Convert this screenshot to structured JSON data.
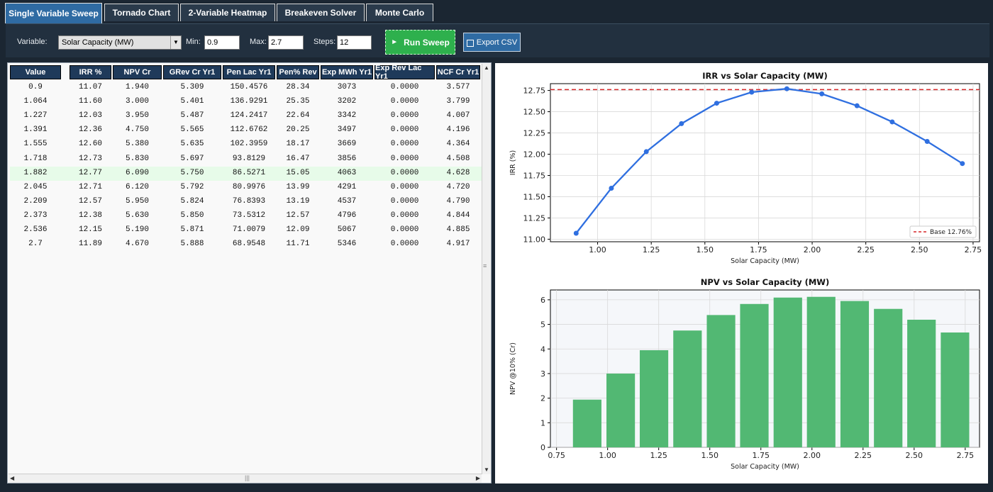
{
  "tabs": [
    {
      "label": "Single Variable Sweep",
      "active": true
    },
    {
      "label": "Tornado Chart",
      "active": false
    },
    {
      "label": "2-Variable Heatmap",
      "active": false
    },
    {
      "label": "Breakeven Solver",
      "active": false
    },
    {
      "label": "Monte Carlo",
      "active": false
    }
  ],
  "toolbar": {
    "variable_label": "Variable:",
    "variable_value": "Solar Capacity (MW)",
    "min_label": "Min:",
    "min_value": "0.9",
    "max_label": "Max:",
    "max_value": "2.7",
    "steps_label": "Steps:",
    "steps_value": "12",
    "run_label": "Run Sweep",
    "export_label": "Export CSV"
  },
  "table": {
    "columns": [
      "Value",
      "IRR %",
      "NPV Cr",
      "GRev Cr Yr1",
      "Pen Lac Yr1",
      "Pen% Rev",
      "Exp MWh Yr1",
      "Exp Rev Lac Yr1",
      "NCF Cr Yr1"
    ],
    "rows": [
      [
        "0.9",
        "11.07",
        "1.940",
        "5.309",
        "150.4576",
        "28.34",
        "3073",
        "0.0000",
        "3.577"
      ],
      [
        "1.064",
        "11.60",
        "3.000",
        "5.401",
        "136.9291",
        "25.35",
        "3202",
        "0.0000",
        "3.799"
      ],
      [
        "1.227",
        "12.03",
        "3.950",
        "5.487",
        "124.2417",
        "22.64",
        "3342",
        "0.0000",
        "4.007"
      ],
      [
        "1.391",
        "12.36",
        "4.750",
        "5.565",
        "112.6762",
        "20.25",
        "3497",
        "0.0000",
        "4.196"
      ],
      [
        "1.555",
        "12.60",
        "5.380",
        "5.635",
        "102.3959",
        "18.17",
        "3669",
        "0.0000",
        "4.364"
      ],
      [
        "1.718",
        "12.73",
        "5.830",
        "5.697",
        "93.8129",
        "16.47",
        "3856",
        "0.0000",
        "4.508"
      ],
      [
        "1.882",
        "12.77",
        "6.090",
        "5.750",
        "86.5271",
        "15.05",
        "4063",
        "0.0000",
        "4.628"
      ],
      [
        "2.045",
        "12.71",
        "6.120",
        "5.792",
        "80.9976",
        "13.99",
        "4291",
        "0.0000",
        "4.720"
      ],
      [
        "2.209",
        "12.57",
        "5.950",
        "5.824",
        "76.8393",
        "13.19",
        "4537",
        "0.0000",
        "4.790"
      ],
      [
        "2.373",
        "12.38",
        "5.630",
        "5.850",
        "73.5312",
        "12.57",
        "4796",
        "0.0000",
        "4.844"
      ],
      [
        "2.536",
        "12.15",
        "5.190",
        "5.871",
        "71.0079",
        "12.09",
        "5067",
        "0.0000",
        "4.885"
      ],
      [
        "2.7",
        "11.89",
        "4.670",
        "5.888",
        "68.9548",
        "11.71",
        "5346",
        "0.0000",
        "4.917"
      ]
    ],
    "highlight_row": 6
  },
  "chart_data": [
    {
      "type": "line",
      "title": "IRR vs Solar Capacity (MW)",
      "xlabel": "Solar Capacity (MW)",
      "ylabel": "IRR (%)",
      "x": [
        0.9,
        1.064,
        1.227,
        1.391,
        1.555,
        1.718,
        1.882,
        2.045,
        2.209,
        2.373,
        2.536,
        2.7
      ],
      "y": [
        11.07,
        11.6,
        12.03,
        12.36,
        12.6,
        12.73,
        12.77,
        12.71,
        12.57,
        12.38,
        12.15,
        11.89
      ],
      "xlim": [
        0.78,
        2.78
      ],
      "ylim": [
        10.97,
        12.83
      ],
      "xticks": [
        "1.00",
        "1.25",
        "1.50",
        "1.75",
        "2.00",
        "2.25",
        "2.50",
        "2.75"
      ],
      "yticks": [
        "11.00",
        "11.25",
        "11.50",
        "11.75",
        "12.00",
        "12.25",
        "12.50",
        "12.75"
      ],
      "baseline": 12.76,
      "legend": "Base 12.76%",
      "legend_position": "lower-right",
      "color": "#2f6fe0",
      "baseline_color": "#d62728",
      "grid": true
    },
    {
      "type": "bar",
      "title": "NPV vs Solar Capacity (MW)",
      "xlabel": "Solar Capacity (MW)",
      "ylabel": "NPV @10% (Cr)",
      "x": [
        0.9,
        1.064,
        1.227,
        1.391,
        1.555,
        1.718,
        1.882,
        2.045,
        2.209,
        2.373,
        2.536,
        2.7
      ],
      "values": [
        1.94,
        3.0,
        3.95,
        4.75,
        5.38,
        5.83,
        6.09,
        6.12,
        5.95,
        5.63,
        5.19,
        4.67
      ],
      "xlim": [
        0.72,
        2.82
      ],
      "ylim": [
        0,
        6.4
      ],
      "xticks": [
        "0.75",
        "1.00",
        "1.25",
        "1.50",
        "1.75",
        "2.00",
        "2.25",
        "2.50",
        "2.75"
      ],
      "yticks": [
        "0",
        "1",
        "2",
        "3",
        "4",
        "5",
        "6"
      ],
      "color": "#52b873",
      "grid": true
    }
  ]
}
